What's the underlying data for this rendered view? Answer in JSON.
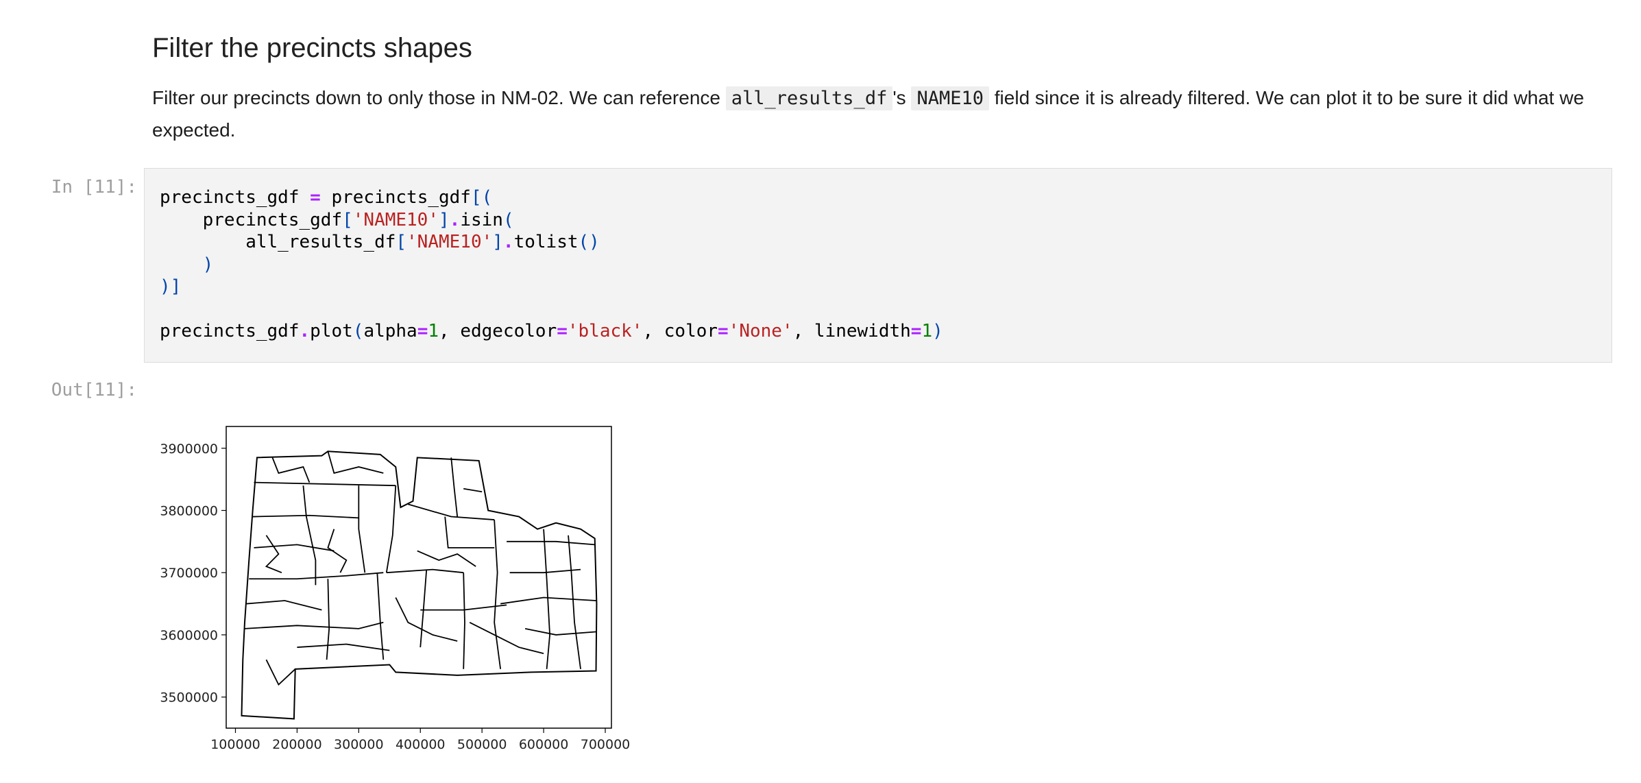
{
  "markdown": {
    "heading": "Filter the precincts shapes",
    "para_before": "Filter our precincts down to only those in NM-02. We can reference ",
    "code_1": "all_results_df",
    "para_mid": "'s ",
    "code_2": "NAME10",
    "para_after": " field since it is already filtered. We can plot it to be sure it did what we expected."
  },
  "cell": {
    "in_prompt": "In [11]:",
    "out_prompt": "Out[11]:",
    "code": {
      "l1_a": "precincts_gdf ",
      "l1_op": "=",
      "l1_b": " precincts_gdf",
      "l1_br": "[(",
      "l2_a": "    precincts_gdf",
      "l2_br1": "[",
      "l2_str": "'NAME10'",
      "l2_br2": "]",
      "l2_dot": ".",
      "l2_b": "isin",
      "l2_br3": "(",
      "l3_a": "        all_results_df",
      "l3_br1": "[",
      "l3_str": "'NAME10'",
      "l3_br2": "]",
      "l3_dot": ".",
      "l3_b": "tolist",
      "l3_br3": "()",
      "l4": "    )",
      "l5": ")]",
      "l7_a": "precincts_gdf",
      "l7_dot": ".",
      "l7_b": "plot",
      "l7_br1": "(",
      "l7_c": "alpha",
      "l7_eq1": "=",
      "l7_n1": "1",
      "l7_d": ", edgecolor",
      "l7_eq2": "=",
      "l7_s1": "'black'",
      "l7_e": ", color",
      "l7_eq3": "=",
      "l7_s2": "'None'",
      "l7_f": ", linewidth",
      "l7_eq4": "=",
      "l7_n2": "1",
      "l7_br2": ")"
    }
  },
  "chart_data": {
    "type": "map",
    "title": "",
    "xlabel": "",
    "ylabel": "",
    "xticks": [
      "100000",
      "200000",
      "300000",
      "400000",
      "500000",
      "600000",
      "700000"
    ],
    "yticks": [
      "3900000",
      "3800000",
      "3700000",
      "3600000",
      "3500000"
    ],
    "xlim": [
      85000,
      710000
    ],
    "ylim": [
      3450000,
      3935000
    ],
    "edgecolor": "#000000",
    "fillcolor": "None",
    "outline": [
      [
        110000,
        3470000
      ],
      [
        195000,
        3465000
      ],
      [
        197000,
        3545000
      ],
      [
        350000,
        3552000
      ],
      [
        360000,
        3540000
      ],
      [
        460000,
        3535000
      ],
      [
        580000,
        3540000
      ],
      [
        685000,
        3542000
      ],
      [
        686000,
        3650000
      ],
      [
        683000,
        3755000
      ],
      [
        660000,
        3770000
      ],
      [
        620000,
        3780000
      ],
      [
        590000,
        3770000
      ],
      [
        560000,
        3790000
      ],
      [
        510000,
        3800000
      ],
      [
        495000,
        3880000
      ],
      [
        395000,
        3885000
      ],
      [
        388000,
        3815000
      ],
      [
        368000,
        3805000
      ],
      [
        360000,
        3870000
      ],
      [
        335000,
        3890000
      ],
      [
        250000,
        3895000
      ],
      [
        240000,
        3888000
      ],
      [
        135000,
        3885000
      ],
      [
        128000,
        3800000
      ],
      [
        122000,
        3720000
      ],
      [
        115000,
        3620000
      ],
      [
        112000,
        3560000
      ]
    ],
    "boundaries": [
      [
        [
          130000,
          3845000
        ],
        [
          360000,
          3840000
        ]
      ],
      [
        [
          128000,
          3790000
        ],
        [
          220000,
          3792000
        ],
        [
          300000,
          3788000
        ]
      ],
      [
        [
          210000,
          3840000
        ],
        [
          215000,
          3790000
        ],
        [
          230000,
          3720000
        ],
        [
          230000,
          3680000
        ]
      ],
      [
        [
          300000,
          3840000
        ],
        [
          300000,
          3770000
        ],
        [
          310000,
          3700000
        ]
      ],
      [
        [
          122000,
          3690000
        ],
        [
          200000,
          3690000
        ],
        [
          280000,
          3695000
        ],
        [
          340000,
          3700000
        ]
      ],
      [
        [
          130000,
          3740000
        ],
        [
          200000,
          3745000
        ],
        [
          260000,
          3735000
        ]
      ],
      [
        [
          115000,
          3610000
        ],
        [
          200000,
          3615000
        ],
        [
          300000,
          3610000
        ],
        [
          340000,
          3620000
        ]
      ],
      [
        [
          118000,
          3650000
        ],
        [
          180000,
          3655000
        ],
        [
          240000,
          3640000
        ]
      ],
      [
        [
          200000,
          3580000
        ],
        [
          280000,
          3585000
        ],
        [
          350000,
          3575000
        ]
      ],
      [
        [
          250000,
          3690000
        ],
        [
          252000,
          3610000
        ],
        [
          248000,
          3560000
        ]
      ],
      [
        [
          330000,
          3700000
        ],
        [
          335000,
          3620000
        ],
        [
          340000,
          3560000
        ]
      ],
      [
        [
          360000,
          3840000
        ],
        [
          355000,
          3760000
        ],
        [
          345000,
          3700000
        ]
      ],
      [
        [
          345000,
          3700000
        ],
        [
          420000,
          3705000
        ],
        [
          470000,
          3700000
        ]
      ],
      [
        [
          410000,
          3705000
        ],
        [
          405000,
          3640000
        ],
        [
          400000,
          3580000
        ]
      ],
      [
        [
          400000,
          3640000
        ],
        [
          470000,
          3640000
        ],
        [
          540000,
          3648000
        ]
      ],
      [
        [
          470000,
          3700000
        ],
        [
          472000,
          3620000
        ],
        [
          470000,
          3545000
        ]
      ],
      [
        [
          380000,
          3810000
        ],
        [
          450000,
          3790000
        ],
        [
          520000,
          3785000
        ]
      ],
      [
        [
          440000,
          3790000
        ],
        [
          445000,
          3740000
        ],
        [
          520000,
          3740000
        ]
      ],
      [
        [
          520000,
          3785000
        ],
        [
          525000,
          3700000
        ],
        [
          520000,
          3620000
        ],
        [
          530000,
          3545000
        ]
      ],
      [
        [
          540000,
          3750000
        ],
        [
          620000,
          3750000
        ],
        [
          683000,
          3745000
        ]
      ],
      [
        [
          545000,
          3700000
        ],
        [
          600000,
          3700000
        ],
        [
          660000,
          3705000
        ]
      ],
      [
        [
          530000,
          3650000
        ],
        [
          600000,
          3660000
        ],
        [
          685000,
          3655000
        ]
      ],
      [
        [
          570000,
          3610000
        ],
        [
          620000,
          3600000
        ],
        [
          686000,
          3605000
        ]
      ],
      [
        [
          600000,
          3770000
        ],
        [
          605000,
          3690000
        ],
        [
          610000,
          3600000
        ],
        [
          605000,
          3545000
        ]
      ],
      [
        [
          640000,
          3760000
        ],
        [
          645000,
          3700000
        ],
        [
          650000,
          3620000
        ],
        [
          660000,
          3545000
        ]
      ],
      [
        [
          470000,
          3835000
        ],
        [
          500000,
          3830000
        ]
      ],
      [
        [
          450000,
          3885000
        ],
        [
          455000,
          3835000
        ],
        [
          460000,
          3790000
        ]
      ],
      [
        [
          250000,
          3895000
        ],
        [
          260000,
          3860000
        ],
        [
          300000,
          3870000
        ],
        [
          340000,
          3860000
        ]
      ],
      [
        [
          160000,
          3885000
        ],
        [
          170000,
          3860000
        ],
        [
          210000,
          3870000
        ],
        [
          220000,
          3845000
        ]
      ],
      [
        [
          150000,
          3560000
        ],
        [
          170000,
          3520000
        ],
        [
          197000,
          3545000
        ]
      ],
      [
        [
          395000,
          3735000
        ],
        [
          430000,
          3720000
        ],
        [
          460000,
          3730000
        ],
        [
          490000,
          3710000
        ]
      ],
      [
        [
          360000,
          3660000
        ],
        [
          380000,
          3620000
        ],
        [
          420000,
          3600000
        ],
        [
          460000,
          3590000
        ]
      ],
      [
        [
          480000,
          3620000
        ],
        [
          520000,
          3600000
        ],
        [
          560000,
          3580000
        ],
        [
          600000,
          3570000
        ]
      ],
      [
        [
          150000,
          3760000
        ],
        [
          170000,
          3730000
        ],
        [
          150000,
          3710000
        ],
        [
          175000,
          3700000
        ]
      ],
      [
        [
          260000,
          3770000
        ],
        [
          250000,
          3740000
        ],
        [
          280000,
          3720000
        ],
        [
          270000,
          3700000
        ]
      ]
    ]
  }
}
